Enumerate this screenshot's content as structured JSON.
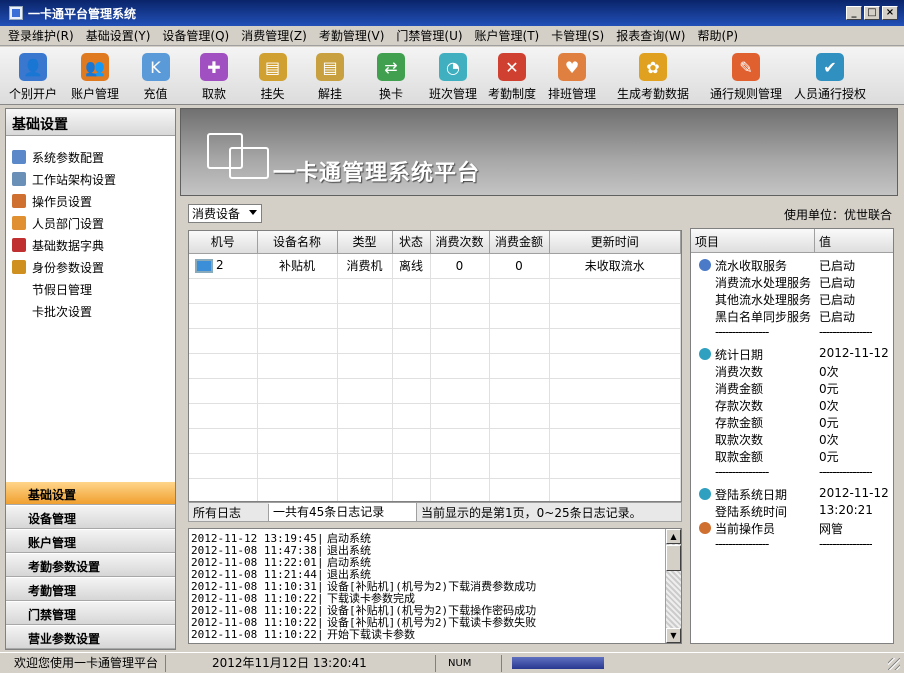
{
  "window": {
    "title": "一卡通平台管理系统"
  },
  "menu": [
    "登录维护(R)",
    "基础设置(Y)",
    "设备管理(Q)",
    "消费管理(Z)",
    "考勤管理(V)",
    "门禁管理(U)",
    "账户管理(T)",
    "卡管理(S)",
    "报表查询(W)",
    "帮助(P)"
  ],
  "toolbar": [
    {
      "label": "个别开户",
      "icon": "single-account-icon",
      "color": "#3a78d0"
    },
    {
      "label": "账户管理",
      "icon": "account-manage-icon",
      "color": "#e07a20"
    },
    {
      "label": "充值",
      "icon": "recharge-icon",
      "color": "#5a9ad8"
    },
    {
      "label": "取款",
      "icon": "withdraw-icon",
      "color": "#a050c0"
    },
    {
      "label": "挂失",
      "icon": "report-loss-icon",
      "color": "#d0a030"
    },
    {
      "label": "解挂",
      "icon": "unlock-loss-icon",
      "color": "#c8a040"
    },
    {
      "label": "换卡",
      "icon": "change-card-icon",
      "color": "#40a050"
    },
    {
      "label": "班次管理",
      "icon": "shift-manage-icon",
      "color": "#40b0c0"
    },
    {
      "label": "考勤制度",
      "icon": "attendance-rule-icon",
      "color": "#d04030"
    },
    {
      "label": "排班管理",
      "icon": "scheduling-icon",
      "color": "#e08040"
    },
    {
      "label": "生成考勤数据",
      "icon": "generate-attendance-icon",
      "color": "#e0a020"
    },
    {
      "label": "通行规则管理",
      "icon": "pass-rule-icon",
      "color": "#e06030"
    },
    {
      "label": "人员通行授权",
      "icon": "pass-authorize-icon",
      "color": "#3090c0"
    }
  ],
  "sidebar": {
    "title": "基础设置",
    "items": [
      {
        "label": "系统参数配置",
        "icon": "system-params-icon",
        "color": "#5a88c8"
      },
      {
        "label": "工作站架构设置",
        "icon": "workstation-icon",
        "color": "#6a90b8"
      },
      {
        "label": "操作员设置",
        "icon": "operator-icon",
        "color": "#d07030"
      },
      {
        "label": "人员部门设置",
        "icon": "department-icon",
        "color": "#e09030"
      },
      {
        "label": "基础数据字典",
        "icon": "dictionary-icon",
        "color": "#c03030"
      },
      {
        "label": "身份参数设置",
        "icon": "identity-icon",
        "color": "#d09020"
      },
      {
        "label": "节假日管理",
        "icon": "",
        "color": ""
      },
      {
        "label": "卡批次设置",
        "icon": "",
        "color": ""
      }
    ],
    "groups": [
      {
        "label": "基础设置",
        "active": true
      },
      {
        "label": "设备管理",
        "active": false
      },
      {
        "label": "账户管理",
        "active": false
      },
      {
        "label": "考勤参数设置",
        "active": false
      },
      {
        "label": "考勤管理",
        "active": false
      },
      {
        "label": "门禁管理",
        "active": false
      },
      {
        "label": "营业参数设置",
        "active": false
      }
    ]
  },
  "banner": {
    "title": "一卡通管理系统平台"
  },
  "device_select": {
    "value": "消费设备"
  },
  "unit": "使用单位：优世联合",
  "device_table": {
    "columns": [
      "机号",
      "设备名称",
      "类型",
      "状态",
      "消费次数",
      "消费金额",
      "更新时间"
    ],
    "rows": [
      [
        "2",
        "补贴机",
        "消费机",
        "离线",
        "0",
        "0",
        "未收取流水"
      ]
    ],
    "empty_rows": 9
  },
  "status_panel": {
    "columns": [
      "项目",
      "值"
    ],
    "groups": [
      {
        "rows": [
          {
            "key": "流水收取服务",
            "value": "已启动",
            "icon": "service-icon"
          },
          {
            "key": "消费流水处理服务",
            "value": "已启动"
          },
          {
            "key": "其他流水处理服务",
            "value": "已启动"
          },
          {
            "key": "黑白名单同步服务",
            "value": "已启动"
          }
        ]
      },
      {
        "rows": [
          {
            "key": "统计日期",
            "value": "2012-11-12",
            "icon": "clock-icon"
          },
          {
            "key": "消费次数",
            "value": "0次"
          },
          {
            "key": "消费金额",
            "value": "0元"
          },
          {
            "key": "存款次数",
            "value": "0次"
          },
          {
            "key": "存款金额",
            "value": "0元"
          },
          {
            "key": "取款次数",
            "value": "0次"
          },
          {
            "key": "取款金额",
            "value": "0元"
          }
        ]
      },
      {
        "rows": [
          {
            "key": "登陆系统日期",
            "value": "2012-11-12",
            "icon": "clock-icon"
          },
          {
            "key": "登陆系统时间",
            "value": "13:20:21"
          },
          {
            "key": "当前操作员",
            "value": "网管",
            "icon": "user-icon"
          }
        ]
      }
    ],
    "separator": "----------------"
  },
  "log_bar": {
    "label": "所有日志",
    "total": "一共有45条日志记录",
    "page_info": "当前显示的是第1页，0~25条日志记录。"
  },
  "logs": [
    {
      "time": "2012-11-12 13:19:45",
      "msg": "启动系统"
    },
    {
      "time": "2012-11-08 11:47:38",
      "msg": "退出系统"
    },
    {
      "time": "2012-11-08 11:22:01",
      "msg": "启动系统"
    },
    {
      "time": "2012-11-08 11:21:44",
      "msg": "退出系统"
    },
    {
      "time": "2012-11-08 11:10:31",
      "msg": "设备[补贴机](机号为2)下载消费参数成功"
    },
    {
      "time": "2012-11-08 11:10:22",
      "msg": "下载读卡参数完成"
    },
    {
      "time": "2012-11-08 11:10:22",
      "msg": "设备[补贴机](机号为2)下载操作密码成功"
    },
    {
      "time": "2012-11-08 11:10:22",
      "msg": "设备[补贴机](机号为2)下载读卡参数失败"
    },
    {
      "time": "2012-11-08 11:10:22",
      "msg": "开始下载读卡参数"
    }
  ],
  "statusbar": {
    "welcome": "欢迎您使用一卡通管理平台",
    "datetime": "2012年11月12日 13:20:41",
    "num": "NUM"
  }
}
